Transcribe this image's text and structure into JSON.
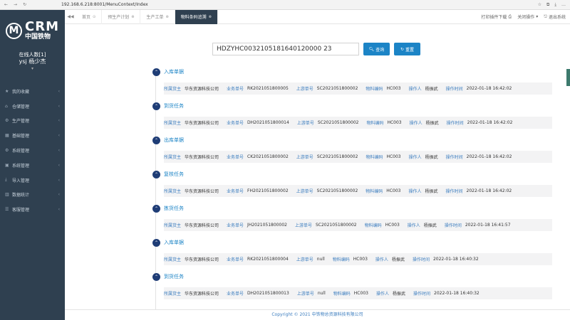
{
  "browser": {
    "url": "192.168.6.218:8001/MenuContext/Index",
    "nav_icons": [
      "←",
      "→",
      "↻"
    ],
    "tools": [
      "☆",
      "⧉",
      "⤓",
      "…"
    ]
  },
  "logo": {
    "mark": "M",
    "brand": "CRM",
    "sub": "中国铁物"
  },
  "user": {
    "online": "在线人数[1]",
    "name": "ysj  杨少杰",
    "caret": "▾"
  },
  "sidebar": {
    "items": [
      {
        "label": "我的收藏",
        "icon": "star-icon",
        "glyph": "★"
      },
      {
        "label": "仓储管理",
        "icon": "home-icon",
        "glyph": "⌂"
      },
      {
        "label": "生产管理",
        "icon": "production-icon",
        "glyph": "⚙"
      },
      {
        "label": "基础管理",
        "icon": "grid-icon",
        "glyph": "▦"
      },
      {
        "label": "系统管理",
        "icon": "gear-icon",
        "glyph": "⚙"
      },
      {
        "label": "系统管理",
        "icon": "cube-icon",
        "glyph": "▣"
      },
      {
        "label": "导入管理",
        "icon": "import-icon",
        "glyph": "⤓"
      },
      {
        "label": "数据统计",
        "icon": "chart-icon",
        "glyph": "▥"
      },
      {
        "label": "客服管理",
        "icon": "list-icon",
        "glyph": "☰"
      }
    ]
  },
  "topbar": {
    "back": "◀◀",
    "tabs": [
      {
        "label": "首页",
        "close": "⊙",
        "active": false
      },
      {
        "label": "预生产计划",
        "close": "⊗",
        "active": false
      },
      {
        "label": "生产工单",
        "close": "⊗",
        "active": false
      },
      {
        "label": "物料条码追溯",
        "close": "⊗",
        "active": true
      }
    ],
    "actions": {
      "more_tabs": "打印插件下载",
      "close_ops": "关闭操作",
      "logout": "退出系统"
    }
  },
  "search": {
    "value": "HDZYHC0032105181640120000 23",
    "query_label": "查询",
    "reset_label": "重置"
  },
  "detail_labels": {
    "supplier": "所属货主",
    "business_no": "业务单号",
    "upstream_no": "上游单号",
    "material_code": "物料编码",
    "operator": "操作人",
    "op_time": "操作时间"
  },
  "timeline": [
    {
      "title": "入库单据",
      "supplier": "华东资源科技公司",
      "business_no": "RK2021051800005",
      "upstream_no": "SC2021051800002",
      "material_code": "HC003",
      "operator": "杨振武",
      "op_time": "2022-01-18 16:42:02"
    },
    {
      "title": "到货任务",
      "supplier": "华东资源科技公司",
      "business_no": "DH2021051800014",
      "upstream_no": "SC2021051800002",
      "material_code": "HC003",
      "operator": "杨振武",
      "op_time": "2022-01-18 16:42:02"
    },
    {
      "title": "出库单据",
      "supplier": "华东资源科技公司",
      "business_no": "CK2021051800002",
      "upstream_no": "SC2021051800002",
      "material_code": "HC003",
      "operator": "杨振武",
      "op_time": "2022-01-18 16:42:02"
    },
    {
      "title": "复核任务",
      "supplier": "华东资源科技公司",
      "business_no": "FH2021051800002",
      "upstream_no": "SC2021051800002",
      "material_code": "HC003",
      "operator": "杨振武",
      "op_time": "2022-01-18 16:42:02"
    },
    {
      "title": "拣货任务",
      "supplier": "华东资源科技公司",
      "business_no": "JH2021051800002",
      "upstream_no": "SC2021051800002",
      "material_code": "HC003",
      "operator": "杨振武",
      "op_time": "2022-01-18 16:41:57"
    },
    {
      "title": "入库单据",
      "supplier": "华东资源科技公司",
      "business_no": "RK2021051800004",
      "upstream_no": "null",
      "material_code": "HC003",
      "operator": "杨振武",
      "op_time": "2022-01-18 16:40:32"
    },
    {
      "title": "到货任务",
      "supplier": "华东资源科技公司",
      "business_no": "DH2021051800013",
      "upstream_no": "null",
      "material_code": "HC003",
      "operator": "杨振武",
      "op_time": "2022-01-18 16:40:32"
    }
  ],
  "footer": {
    "copyright": "Copyright © 2021 中铁物总资源科技有限公司"
  }
}
